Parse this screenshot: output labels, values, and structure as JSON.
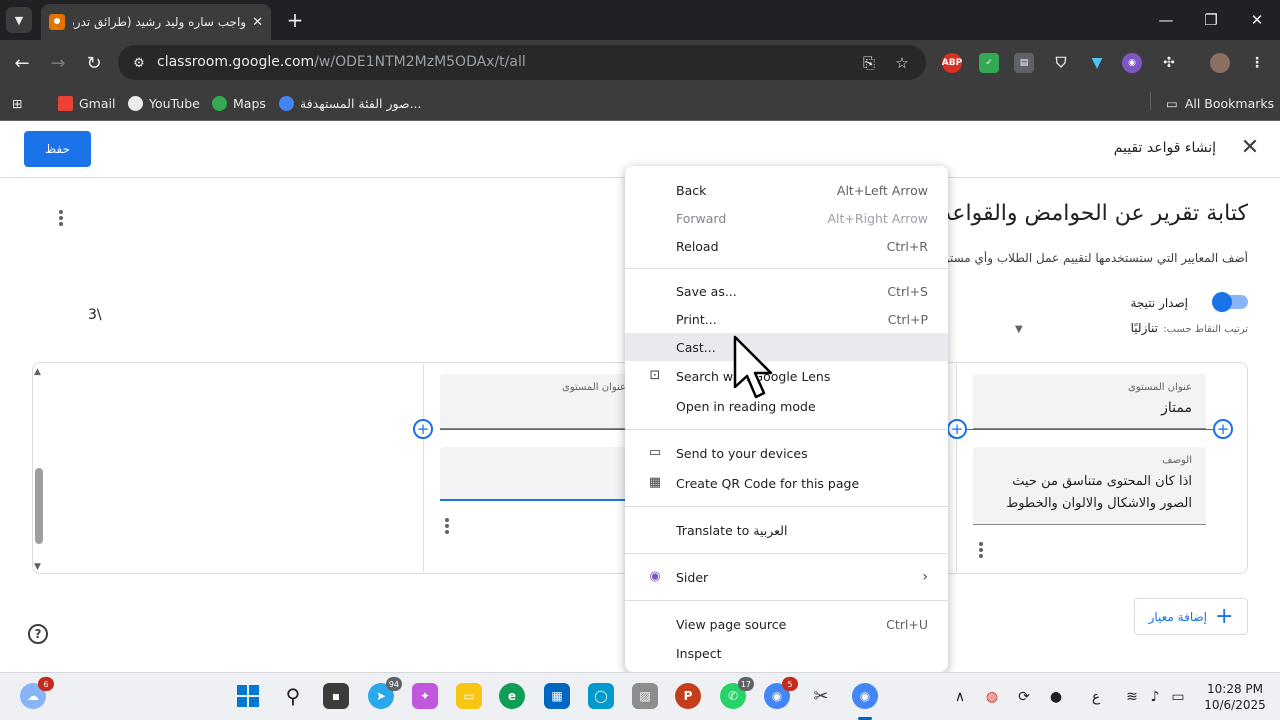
{
  "browser": {
    "tab_title": "واجب ساره وليد رشيد (طرائق تدريس",
    "url_host": "classroom.google.com",
    "url_path": "/w/ODE1NTM2MzM5ODAx/t/all",
    "bookmarks": [
      {
        "label": "Gmail",
        "color": "#ea4335"
      },
      {
        "label": "YouTube",
        "color": "#e8eaed"
      },
      {
        "label": "Maps",
        "color": "#34a853"
      },
      {
        "label": "صور الفئة المستهدفة...",
        "color": "#4285f4"
      }
    ],
    "all_bookmarks": "All Bookmarks",
    "extension_abp": "ABP"
  },
  "page": {
    "save_label": "حفظ",
    "heading": "إنشاء قواعد تقييم",
    "rubric_title": "كتابة تقرير عن الحوامض والقواعد",
    "rubric_desc": "أضف المعايير التي ستستخدمها لتقييم عمل الطلاب وأي مستويات أداء لكل معيار. يمكنك إعادة استخدامها لكل المهمة.",
    "score_label": "إصدار نتيجة",
    "sort_label": "ترتيب النقاط حسب:",
    "sort_value": "تنازليًا",
    "points": "3\\",
    "level_title_label": "عنوان المستوى",
    "level_title_value": "ممتاز",
    "description_label": "الوصف",
    "description_value": "اذا كان المحتوى متناسق من حيث الصور والاشكال والالوان والخطوط",
    "level2_title_label": "عنوان المستوى",
    "add_criterion": "إضافة معيار"
  },
  "menu": {
    "groups": [
      [
        {
          "label": "Back",
          "shortcut": "Alt+Left Arrow",
          "disabled": false
        },
        {
          "label": "Forward",
          "shortcut": "Alt+Right Arrow",
          "disabled": true
        },
        {
          "label": "Reload",
          "shortcut": "Ctrl+R",
          "disabled": false
        }
      ],
      [
        {
          "label": "Save as...",
          "shortcut": "Ctrl+S"
        },
        {
          "label": "Print...",
          "shortcut": "Ctrl+P"
        },
        {
          "label": "Cast...",
          "shortcut": ""
        },
        {
          "label": "Search with Google Lens",
          "icon": "lens-icon"
        },
        {
          "label": "Open in reading mode",
          "shortcut": ""
        }
      ],
      [
        {
          "label": "Send to your devices",
          "icon": "devices-icon"
        },
        {
          "label": "Create QR Code for this page",
          "icon": "qr-code-icon"
        }
      ],
      [
        {
          "label": "Translate to العربية"
        }
      ],
      [
        {
          "label": "Sider",
          "icon": "sider-icon",
          "submenu": true
        }
      ],
      [
        {
          "label": "View page source",
          "shortcut": "Ctrl+U"
        },
        {
          "label": "Inspect"
        }
      ]
    ]
  },
  "taskbar": {
    "weather_badge": "6",
    "telegram_badge": "94",
    "whatsapp_badge": "17",
    "chrome_badge": "5",
    "lang": "ع",
    "time": "10:28 PM",
    "date": "10/6/2025"
  },
  "colors": {
    "accent": "#1a73e8",
    "chrome_dark": "#3c3c3c"
  }
}
